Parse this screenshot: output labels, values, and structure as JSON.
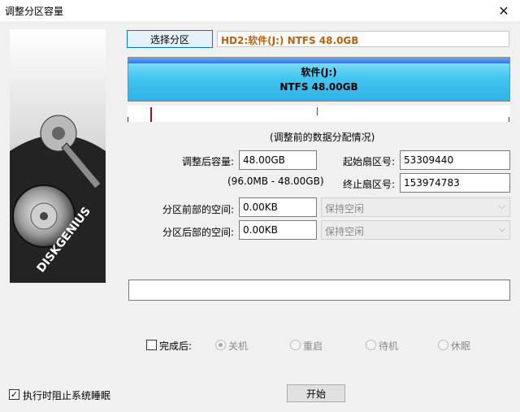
{
  "window": {
    "title": "调整分区容量",
    "close_glyph": "✕"
  },
  "brand": {
    "logo_text": "DISKGENIUS"
  },
  "select_partition_button": "选择分区",
  "partition_info": "HD2:软件(J:) NTFS 48.0GB",
  "partition_bar": {
    "name": "软件(J:)",
    "detail": "NTFS 48.00GB",
    "color": "#45c6f0"
  },
  "distribution_caption": "(调整前的数据分配情况)",
  "form": {
    "size_after_label": "调整后容量:",
    "size_after_value": "48.00GB",
    "size_range": "(96.0MB - 48.00GB)",
    "start_sector_label": "起始扇区号:",
    "start_sector_value": "53309440",
    "end_sector_label": "终止扇区号:",
    "end_sector_value": "153974783",
    "space_before_label": "分区前部的空间:",
    "space_before_value": "0.00KB",
    "space_before_option": "保持空闲",
    "space_after_label": "分区后部的空间:",
    "space_after_value": "0.00KB",
    "space_after_option": "保持空闲"
  },
  "after_completion": {
    "label": "完成后:",
    "checked": false,
    "options": [
      "关机",
      "重启",
      "待机",
      "休眠"
    ],
    "selected": "关机"
  },
  "prevent_sleep": {
    "label": "执行时阻止系统睡眠",
    "checked": true,
    "check_glyph": "✓"
  },
  "start_button": "开始"
}
